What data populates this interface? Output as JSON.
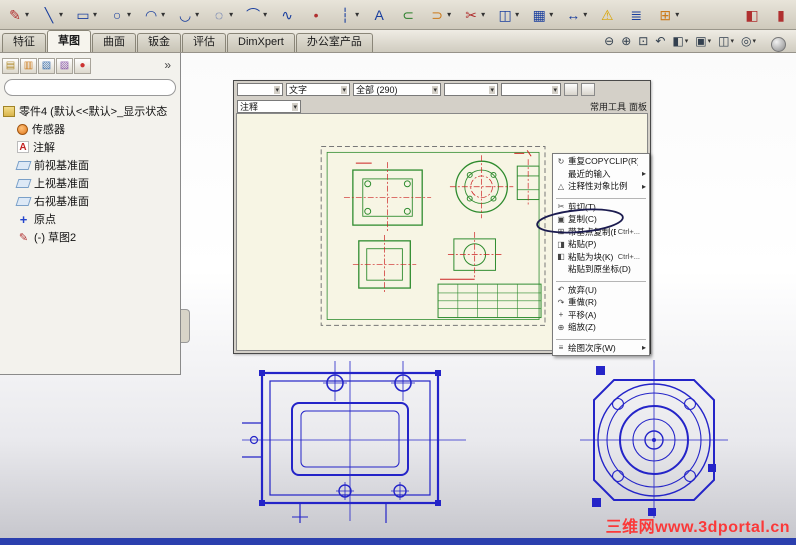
{
  "colors": {
    "toolbar_bg": "#d6d2c6",
    "tab_active_bg": "#f6f4ed",
    "canvas_bg": "#f7f5e4",
    "sketch_blue": "#2424c8",
    "drawing_green": "#2e8b2e",
    "drawing_red": "#cc2222",
    "watermark_red": "#ff2d2d",
    "taskbar_blue": "#2b3fae",
    "menu_bg": "#fdfdfd"
  },
  "toolbar": {
    "tools": [
      {
        "name": "sketch-tool",
        "glyph": "✎",
        "color": "#b03030",
        "dd": true
      },
      {
        "name": "line-tool",
        "glyph": "╲",
        "color": "#1a3f9e",
        "dd": true
      },
      {
        "name": "rectangle-tool",
        "glyph": "▭",
        "color": "#1a3f9e",
        "dd": true
      },
      {
        "name": "circle-tool",
        "glyph": "○",
        "color": "#1a3f9e",
        "dd": true
      },
      {
        "name": "centerpoint-arc-tool",
        "glyph": "◠",
        "color": "#1a3f9e",
        "dd": true
      },
      {
        "name": "tangent-arc-tool",
        "glyph": "◡",
        "color": "#1a3f9e",
        "dd": true
      },
      {
        "name": "ellipse-tool",
        "glyph": "◌",
        "color": "#1a3f9e",
        "dd": true
      },
      {
        "name": "three-point-arc-tool",
        "glyph": "⌒",
        "color": "#1a3f9e",
        "dd": true
      },
      {
        "name": "spline-tool",
        "glyph": "∿",
        "color": "#1a3f9e",
        "dd": false
      },
      {
        "name": "point-tool",
        "glyph": "•",
        "color": "#b03030",
        "dd": false
      },
      {
        "name": "centerline-tool",
        "glyph": "┆",
        "color": "#1a3f9e",
        "dd": true
      },
      {
        "name": "text-tool",
        "glyph": "A",
        "color": "#1a3f9e",
        "dd": false
      },
      {
        "name": "convert-entities-tool",
        "glyph": "⊂",
        "color": "#2a7f2a",
        "dd": false
      },
      {
        "name": "offset-entities-tool",
        "glyph": "⊃",
        "color": "#cc7a1a",
        "dd": true
      },
      {
        "name": "trim-entities-tool",
        "glyph": "✂",
        "color": "#b03030",
        "dd": true
      },
      {
        "name": "mirror-entities-tool",
        "glyph": "◫",
        "color": "#1a3f9e",
        "dd": true
      },
      {
        "name": "linear-pattern-tool",
        "glyph": "▦",
        "color": "#1a3f9e",
        "dd": true
      },
      {
        "name": "move-entities-tool",
        "glyph": "↔",
        "color": "#1a3f9e",
        "dd": true
      },
      {
        "name": "display-relations-tool",
        "glyph": "⚠",
        "color": "#d9a400",
        "dd": false
      },
      {
        "name": "repair-sketch-tool",
        "glyph": "≣",
        "color": "#1a3f9e",
        "dd": false
      },
      {
        "name": "rapid-sketch-tool",
        "glyph": "⊞",
        "color": "#cc7a1a",
        "dd": true
      },
      {
        "name": "instant2d-tool",
        "glyph": "◧",
        "color": "#b03030",
        "dd": false
      },
      {
        "name": "toolbar-overflow-icon",
        "glyph": "▮",
        "color": "#b03030",
        "dd": false
      }
    ]
  },
  "ribbon": {
    "tabs": [
      {
        "name": "tab-features",
        "label": "特征",
        "active": false
      },
      {
        "name": "tab-sketch",
        "label": "草图",
        "active": true
      },
      {
        "name": "tab-surfaces",
        "label": "曲面",
        "active": false
      },
      {
        "name": "tab-sheet-metal",
        "label": "钣金",
        "active": false
      },
      {
        "name": "tab-evaluate",
        "label": "评估",
        "active": false
      },
      {
        "name": "tab-dimxpert",
        "label": "DimXpert",
        "active": false
      },
      {
        "name": "tab-office-products",
        "label": "办公室产品",
        "active": false
      }
    ]
  },
  "view_toolbar": {
    "buttons": [
      {
        "name": "zoom-out-button",
        "glyph": "⊖",
        "dd": false
      },
      {
        "name": "zoom-area-button",
        "glyph": "⊕",
        "dd": false
      },
      {
        "name": "zoom-fit-button",
        "glyph": "⊡",
        "dd": false
      },
      {
        "name": "previous-view-button",
        "glyph": "↶",
        "dd": false
      },
      {
        "name": "section-view-button",
        "glyph": "◧",
        "dd": true
      },
      {
        "name": "view-orientation-button",
        "glyph": "▣",
        "dd": true
      },
      {
        "name": "display-style-button",
        "glyph": "◫",
        "dd": true
      },
      {
        "name": "hide-show-items-button",
        "glyph": "◎",
        "dd": true
      }
    ]
  },
  "panel": {
    "tabs": [
      {
        "name": "featuremanager-tab",
        "glyph": "▤",
        "color": "#b08a2a"
      },
      {
        "name": "propertymanager-tab",
        "glyph": "▥",
        "color": "#cc7a1a"
      },
      {
        "name": "configurationmanager-tab",
        "glyph": "▧",
        "color": "#3a6fb0"
      },
      {
        "name": "dimxpertmanager-tab",
        "glyph": "▨",
        "color": "#8855aa"
      },
      {
        "name": "appearances-tab",
        "glyph": "●",
        "color": "#cc3333"
      }
    ],
    "chevron": "»",
    "tree": {
      "root": "零件4 (默认<<默认>_显示状态",
      "items": [
        {
          "name": "tree-item-sensors",
          "label": "传感器",
          "icon_type": "sensor",
          "icon_glyph": ""
        },
        {
          "name": "tree-item-annotations",
          "label": "注解",
          "icon_type": "annotation",
          "icon_glyph": "A"
        },
        {
          "name": "tree-item-front-plane",
          "label": "前视基准面",
          "icon_type": "plane",
          "icon_glyph": ""
        },
        {
          "name": "tree-item-top-plane",
          "label": "上视基准面",
          "icon_type": "plane",
          "icon_glyph": ""
        },
        {
          "name": "tree-item-right-plane",
          "label": "右视基准面",
          "icon_type": "plane",
          "icon_glyph": ""
        },
        {
          "name": "tree-item-origin",
          "label": "原点",
          "icon_type": "origin",
          "icon_glyph": "+"
        },
        {
          "name": "tree-item-sketch2",
          "label": "(-) 草图2",
          "icon_type": "sketch",
          "icon_glyph": "✎"
        }
      ]
    }
  },
  "acad": {
    "toolbar": {
      "layer_combo": "文字",
      "filter_combo": "全部 (290)",
      "annotation_combo": "注释",
      "tools_label": "常用工具",
      "panel_label": "面板"
    }
  },
  "context_menu": {
    "items": [
      {
        "name": "menu-repeat-copyclip",
        "label": "重复COPYCLIP(R)",
        "icon_glyph": "↻",
        "submenu": false
      },
      {
        "name": "menu-recent-input",
        "label": "最近的输入",
        "submenu": true
      },
      {
        "name": "menu-annotative-object-scale",
        "label": "注释性对象比例",
        "icon_glyph": "△",
        "submenu": true
      },
      {
        "separator": true
      },
      {
        "name": "menu-cut",
        "label": "剪切(T)",
        "icon_glyph": "✂",
        "submenu": false
      },
      {
        "name": "menu-copy",
        "label": "复制(C)",
        "icon_glyph": "▣",
        "circled": true,
        "submenu": false
      },
      {
        "name": "menu-copy-with-base-point",
        "label": "带基点复制(B)",
        "icon_glyph": "⊞",
        "shortcut": "Ctrl+...",
        "submenu": false
      },
      {
        "name": "menu-paste",
        "label": "粘贴(P)",
        "icon_glyph": "◨",
        "submenu": false
      },
      {
        "name": "menu-paste-as-block",
        "label": "粘贴为块(K)",
        "icon_glyph": "◧",
        "shortcut": "Ctrl+...",
        "submenu": false
      },
      {
        "name": "menu-paste-to-original-coords",
        "label": "粘贴到原坐标(D)",
        "submenu": false
      },
      {
        "separator": true
      },
      {
        "name": "menu-undo",
        "label": "放弃(U)",
        "icon_glyph": "↶",
        "submenu": false
      },
      {
        "name": "menu-redo",
        "label": "重做(R)",
        "icon_glyph": "↷",
        "submenu": false
      },
      {
        "name": "menu-pan",
        "label": "平移(A)",
        "icon_glyph": "+",
        "submenu": false
      },
      {
        "name": "menu-zoom",
        "label": "缩放(Z)",
        "icon_glyph": "⊕",
        "submenu": false
      },
      {
        "separator": true
      },
      {
        "name": "menu-draw-order",
        "label": "绘图次序(W)",
        "icon_glyph": "≡",
        "submenu": true
      }
    ]
  },
  "watermark": {
    "text": "三维网www.3dportal.cn"
  }
}
